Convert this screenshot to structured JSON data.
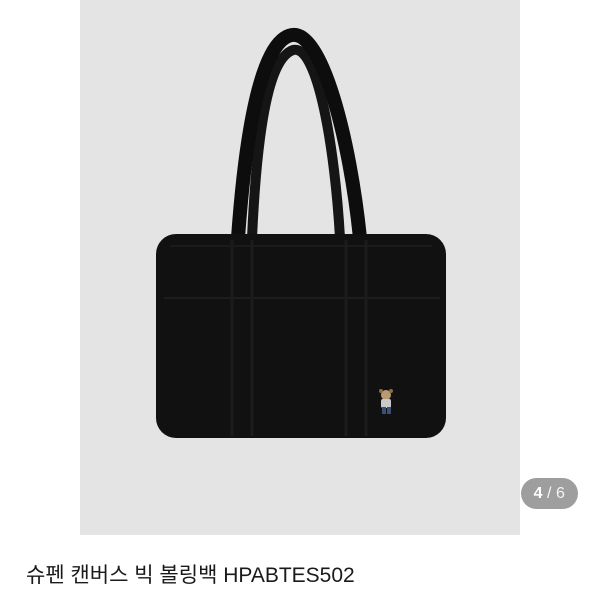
{
  "product": {
    "title": "슈펜 캔버스 빅 볼링백 HPABTES502",
    "image_alt": "black canvas bowling bag"
  },
  "gallery": {
    "current_page": "4",
    "separator": "/",
    "total_pages": "6"
  },
  "colors": {
    "photo_background": "#e4e4e4",
    "bag": "#0f0f0f",
    "indicator_bg": "#787878"
  }
}
